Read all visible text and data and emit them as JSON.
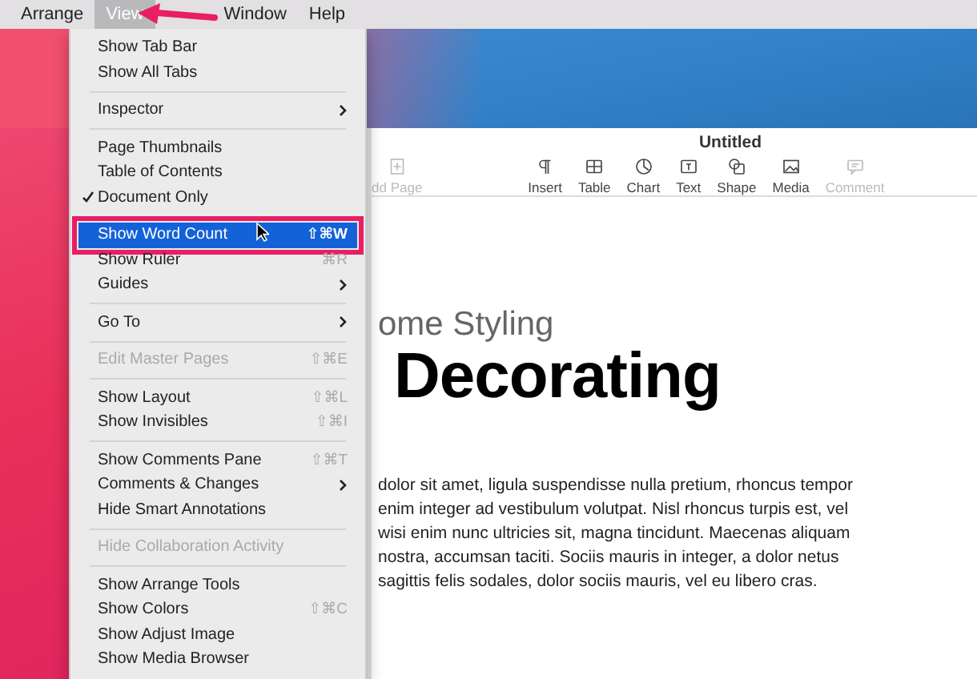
{
  "menubar": {
    "items": [
      {
        "label": "Arrange",
        "selected": false
      },
      {
        "label": "View",
        "selected": true
      },
      {
        "label": "Window",
        "selected": false
      },
      {
        "label": "Help",
        "selected": false
      }
    ]
  },
  "menu": {
    "items": [
      {
        "kind": "item",
        "label": "Show Tab Bar",
        "checked": false,
        "disabled": false,
        "submenu": false,
        "selected": false
      },
      {
        "kind": "item",
        "label": "Show All Tabs",
        "checked": false,
        "disabled": false,
        "submenu": false,
        "selected": false
      },
      {
        "kind": "separator"
      },
      {
        "kind": "item",
        "label": "Inspector",
        "checked": false,
        "disabled": false,
        "submenu": true,
        "selected": false
      },
      {
        "kind": "separator"
      },
      {
        "kind": "item",
        "label": "Page Thumbnails",
        "checked": false,
        "disabled": false,
        "submenu": false,
        "selected": false
      },
      {
        "kind": "item",
        "label": "Table of Contents",
        "checked": false,
        "disabled": false,
        "submenu": false,
        "selected": false
      },
      {
        "kind": "item",
        "label": "Document Only",
        "checked": true,
        "disabled": false,
        "submenu": false,
        "selected": false
      },
      {
        "kind": "separator"
      },
      {
        "kind": "item",
        "label": "Show Word Count",
        "shortcut": "⇧⌘W",
        "checked": false,
        "disabled": false,
        "submenu": false,
        "selected": true
      },
      {
        "kind": "item",
        "label": "Show Ruler",
        "shortcut": "⌘R",
        "checked": false,
        "disabled": false,
        "submenu": false,
        "selected": false
      },
      {
        "kind": "item",
        "label": "Guides",
        "checked": false,
        "disabled": false,
        "submenu": true,
        "selected": false
      },
      {
        "kind": "separator"
      },
      {
        "kind": "item",
        "label": "Go To",
        "checked": false,
        "disabled": false,
        "submenu": true,
        "selected": false
      },
      {
        "kind": "separator"
      },
      {
        "kind": "item",
        "label": "Edit Master Pages",
        "shortcut": "⇧⌘E",
        "checked": false,
        "disabled": true,
        "submenu": false,
        "selected": false
      },
      {
        "kind": "separator"
      },
      {
        "kind": "item",
        "label": "Show Layout",
        "shortcut": "⇧⌘L",
        "checked": false,
        "disabled": false,
        "submenu": false,
        "selected": false
      },
      {
        "kind": "item",
        "label": "Show Invisibles",
        "shortcut": "⇧⌘I",
        "checked": false,
        "disabled": false,
        "submenu": false,
        "selected": false
      },
      {
        "kind": "separator"
      },
      {
        "kind": "item",
        "label": "Show Comments Pane",
        "shortcut": "⇧⌘T",
        "checked": false,
        "disabled": false,
        "submenu": false,
        "selected": false
      },
      {
        "kind": "item",
        "label": "Comments & Changes",
        "checked": false,
        "disabled": false,
        "submenu": true,
        "selected": false
      },
      {
        "kind": "item",
        "label": "Hide Smart Annotations",
        "checked": false,
        "disabled": false,
        "submenu": false,
        "selected": false
      },
      {
        "kind": "separator"
      },
      {
        "kind": "item",
        "label": "Hide Collaboration Activity",
        "checked": false,
        "disabled": true,
        "submenu": false,
        "selected": false
      },
      {
        "kind": "separator"
      },
      {
        "kind": "item",
        "label": "Show Arrange Tools",
        "checked": false,
        "disabled": false,
        "submenu": false,
        "selected": false
      },
      {
        "kind": "item",
        "label": "Show Colors",
        "shortcut": "⇧⌘C",
        "checked": false,
        "disabled": false,
        "submenu": false,
        "selected": false
      },
      {
        "kind": "item",
        "label": "Show Adjust Image",
        "checked": false,
        "disabled": false,
        "submenu": false,
        "selected": false
      },
      {
        "kind": "item",
        "label": "Show Media Browser",
        "checked": false,
        "disabled": false,
        "submenu": false,
        "selected": false
      }
    ]
  },
  "window": {
    "title": "Untitled",
    "toolbar": [
      {
        "kind": "add-page",
        "label": "dd Page",
        "disabled": true
      },
      {
        "kind": "insert",
        "label": "Insert",
        "disabled": false
      },
      {
        "kind": "table",
        "label": "Table",
        "disabled": false
      },
      {
        "kind": "chart",
        "label": "Chart",
        "disabled": false
      },
      {
        "kind": "text",
        "label": "Text",
        "disabled": false
      },
      {
        "kind": "shape",
        "label": "Shape",
        "disabled": false
      },
      {
        "kind": "media",
        "label": "Media",
        "disabled": false
      },
      {
        "kind": "comment",
        "label": "Comment",
        "disabled": true
      }
    ]
  },
  "document": {
    "subtitle": "ome Styling",
    "title": "Decorating",
    "body": [
      "dolor sit amet, ligula suspendisse nulla pretium, rhoncus tempor",
      "enim integer ad vestibulum volutpat. Nisl rhoncus turpis est, vel",
      "wisi enim nunc ultricies sit, magna tincidunt. Maecenas aliquam",
      "nostra, accumsan taciti. Sociis mauris in integer, a dolor netus",
      "sagittis felis sodales, dolor sociis mauris, vel eu libero cras."
    ]
  }
}
